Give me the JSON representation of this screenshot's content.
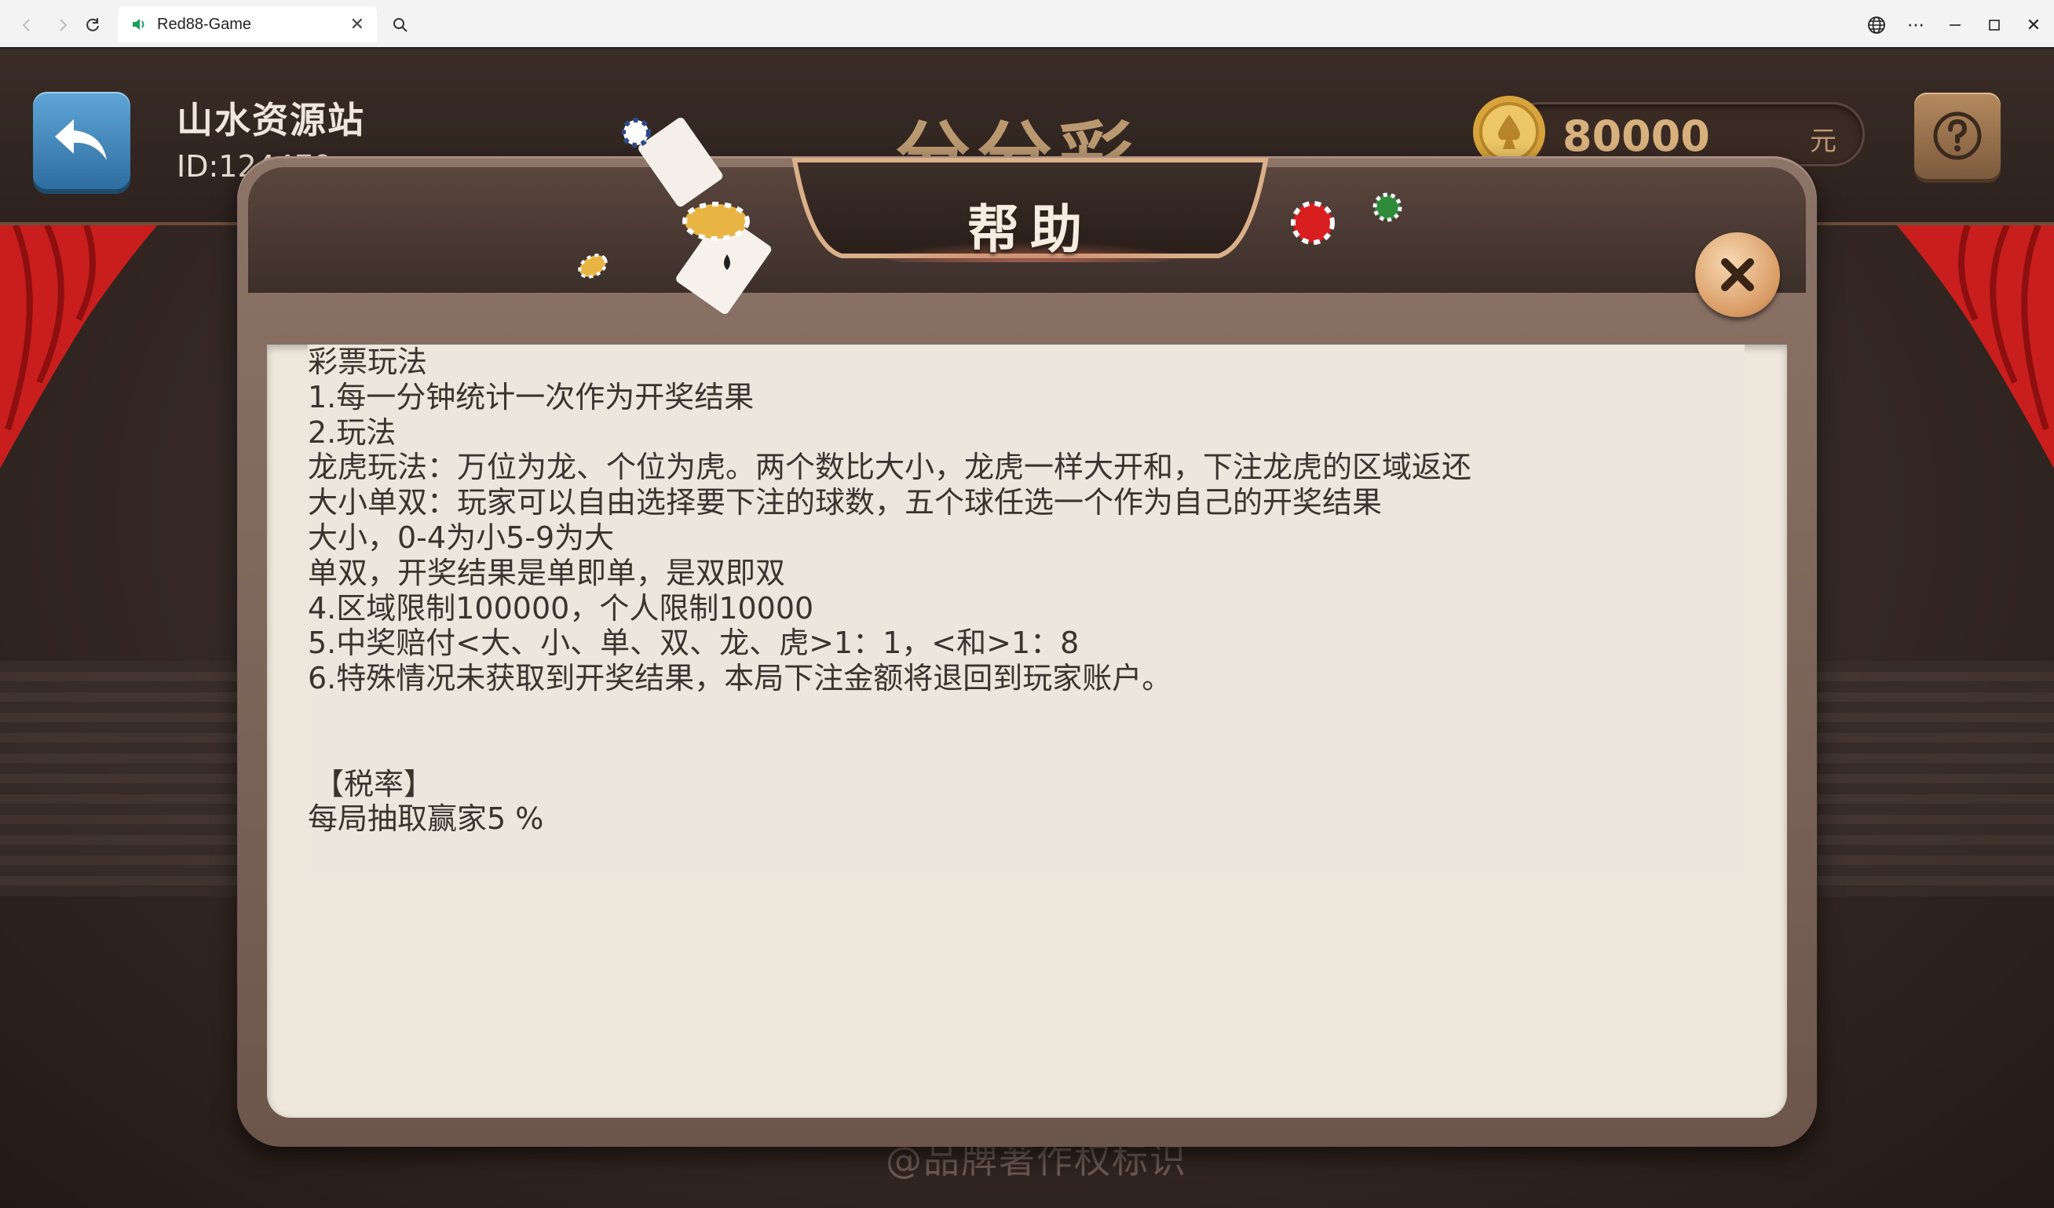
{
  "browser": {
    "tab_title": "Red88-Game",
    "back_icon": "chevron-left-icon",
    "forward_icon": "chevron-right-icon",
    "reload_icon": "reload-icon",
    "controls": [
      "globe-icon",
      "more-icon",
      "minimize-icon",
      "maximize-icon",
      "close-icon"
    ]
  },
  "game": {
    "user_name": "山水资源站",
    "user_id": "ID:124479",
    "title": "分分彩",
    "balance": "80000",
    "balance_unit": "元",
    "watermark": "@品牌著作权标识"
  },
  "dialog": {
    "title": "帮助",
    "lines": [
      "彩票玩法",
      "1.每一分钟统计一次作为开奖结果",
      "2.玩法",
      "龙虎玩法：万位为龙、个位为虎。两个数比大小，龙虎一样大开和，下注龙虎的区域返还",
      "大小单双：玩家可以自由选择要下注的球数，五个球任选一个作为自己的开奖结果",
      "大小，0-4为小5-9为大",
      "单双，开奖结果是单即单，是双即双",
      "4.区域限制100000，个人限制10000",
      "5.中奖赔付<大、小、单、双、龙、虎>1：1，<和>1：8",
      "6.特殊情况未获取到开奖结果，本局下注金额将退回到玩家账户。"
    ],
    "tax_heading": "【税率】",
    "tax_text": "每局抽取赢家5 %"
  },
  "colors": {
    "accent_gold": "#d7b17d",
    "back_button_blue": "#3f86bb",
    "dialog_frame": "#7a6257",
    "content_bg": "#ede7dc",
    "curtain_red": "#c81e1e"
  }
}
